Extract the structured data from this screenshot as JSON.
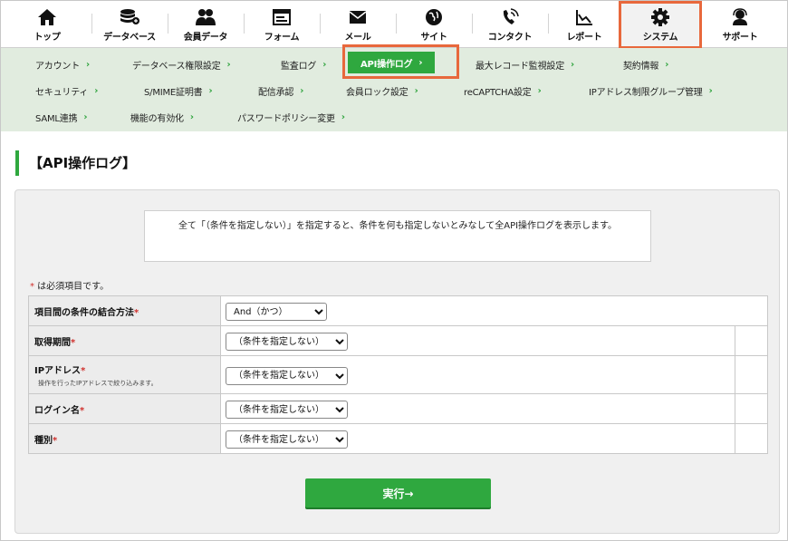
{
  "topnav": {
    "items": [
      {
        "label": "トップ",
        "icon": "home-icon"
      },
      {
        "label": "データベース",
        "icon": "database-icon"
      },
      {
        "label": "会員データ",
        "icon": "members-icon"
      },
      {
        "label": "フォーム",
        "icon": "form-icon"
      },
      {
        "label": "メール",
        "icon": "mail-icon"
      },
      {
        "label": "サイト",
        "icon": "site-icon"
      },
      {
        "label": "コンタクト",
        "icon": "contact-icon"
      },
      {
        "label": "レポート",
        "icon": "report-icon"
      },
      {
        "label": "システム",
        "icon": "gear-icon"
      },
      {
        "label": "サポート",
        "icon": "support-icon"
      }
    ],
    "active": "システム"
  },
  "subnav": {
    "items": [
      "アカウント",
      "データベース権限設定",
      "監査ログ",
      "API操作ログ",
      "最大レコード監視設定",
      "契約情報",
      "セキュリティ",
      "S/MIME証明書",
      "配信承認",
      "会員ロック設定",
      "reCAPTCHA設定",
      "IPアドレス制限グループ管理",
      "SAML連携",
      "機能の有効化",
      "パスワードポリシー変更"
    ],
    "active": "API操作ログ"
  },
  "page_title": "【API操作ログ】",
  "notice": "全て「（条件を指定しない）」を指定すると、条件を何も指定しないとみなして全API操作ログを表示します。",
  "required_note": {
    "mark": "*",
    "text": " は必須項目です。"
  },
  "form": {
    "rows": [
      {
        "label": "項目間の条件の結合方法",
        "required_mark": "*",
        "value": "And（かつ）"
      },
      {
        "label": "取得期間",
        "required_mark": "*",
        "value": "（条件を指定しない）"
      },
      {
        "label": "IPアドレス",
        "required_mark": "*",
        "sublabel": "操作を行ったIPアドレスで絞り込みます。",
        "value": "（条件を指定しない）"
      },
      {
        "label": "ログイン名",
        "required_mark": "*",
        "value": "（条件を指定しない）"
      },
      {
        "label": "種別",
        "required_mark": "*",
        "value": "（条件を指定しない）"
      }
    ]
  },
  "execute_button": "実行→",
  "colors": {
    "accent": "#2fa83f",
    "subnav_bg": "#e1ecdf",
    "highlight": "#e8683c",
    "required": "#d0312d"
  }
}
